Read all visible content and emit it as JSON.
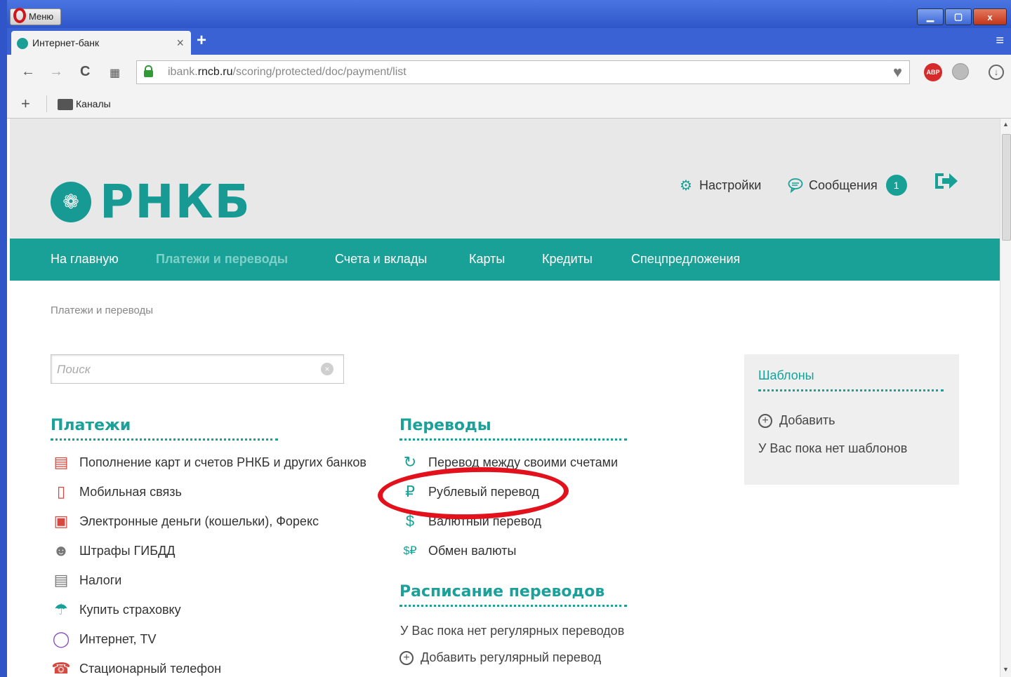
{
  "window": {
    "menu_label": "Меню",
    "minimize": "▁",
    "maximize": "▢",
    "close": "x"
  },
  "tab": {
    "title": "Интернет-банк",
    "close": "×",
    "new_tab": "+"
  },
  "address": {
    "url_prefix": "ibank.",
    "url_domain": "rncb.ru",
    "url_path": "/scoring/protected/doc/payment/list",
    "adblock_label": "ABP"
  },
  "bookmarks": {
    "folder_label": "Каналы"
  },
  "header": {
    "logo_text": "РНКБ",
    "settings_label": "Настройки",
    "messages_label": "Сообщения",
    "messages_count": "1"
  },
  "nav": {
    "items": [
      {
        "label": "На главную"
      },
      {
        "label": "Платежи и переводы",
        "active": true
      },
      {
        "label": "Счета и вклады"
      },
      {
        "label": "Карты"
      },
      {
        "label": "Кредиты"
      },
      {
        "label": "Спецпредложения"
      }
    ]
  },
  "breadcrumb": "Платежи и переводы",
  "search": {
    "placeholder": "Поиск"
  },
  "payments": {
    "title": "Платежи",
    "items": [
      {
        "label": "Пополнение карт и счетов РНКБ и других банков",
        "icon": "card-stack-icon"
      },
      {
        "label": "Мобильная связь",
        "icon": "mobile-phone-icon"
      },
      {
        "label": "Электронные деньги (кошельки), Форекс",
        "icon": "wallet-icon"
      },
      {
        "label": "Штрафы ГИБДД",
        "icon": "police-officer-icon"
      },
      {
        "label": "Налоги",
        "icon": "tax-document-icon"
      },
      {
        "label": "Купить страховку",
        "icon": "umbrella-icon"
      },
      {
        "label": "Интернет, TV",
        "icon": "internet-tv-icon"
      },
      {
        "label": "Стационарный телефон",
        "icon": "landline-phone-icon"
      }
    ]
  },
  "transfers": {
    "title": "Переводы",
    "items": [
      {
        "label": "Перевод между своими счетами",
        "icon": "circular-arrows-icon"
      },
      {
        "label": "Рублевый перевод",
        "icon": "ruble-transfer-icon"
      },
      {
        "label": "Валютный перевод",
        "icon": "currency-transfer-icon"
      },
      {
        "label": "Обмен валюты",
        "icon": "currency-exchange-icon"
      }
    ]
  },
  "schedule": {
    "title": "Расписание переводов",
    "empty_text": "У Вас пока нет регулярных переводов",
    "add_label": "Добавить регулярный перевод"
  },
  "templates": {
    "title": "Шаблоны",
    "add_label": "Добавить",
    "empty_text": "У Вас пока нет шаблонов"
  },
  "colors": {
    "brand_teal": "#1aa197",
    "highlight_red": "#e2111c"
  }
}
